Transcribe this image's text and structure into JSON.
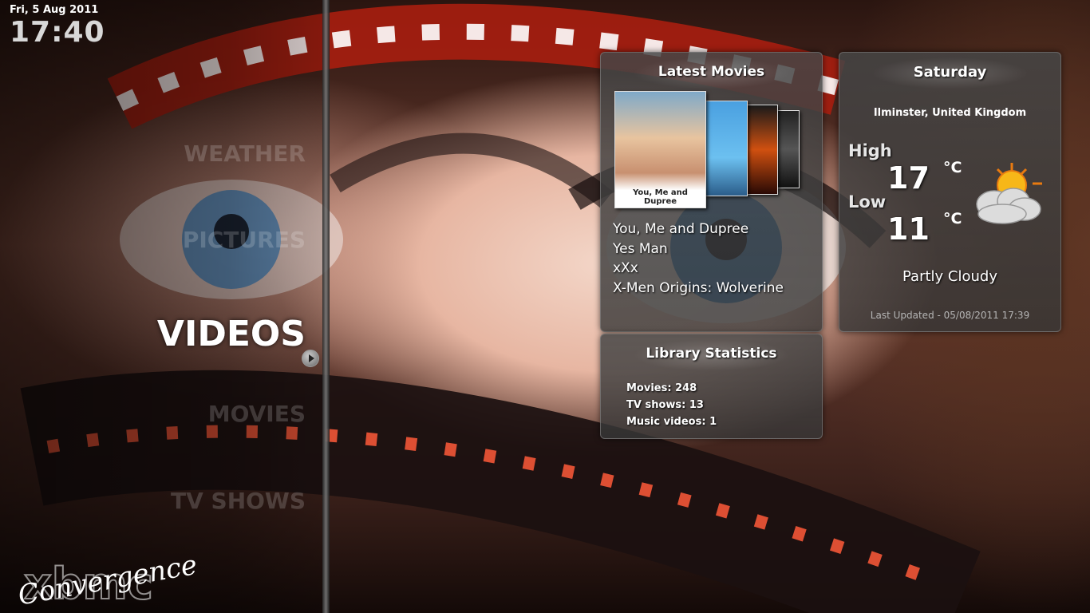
{
  "clock": {
    "date": "Fri, 5 Aug 2011",
    "time": "17:40"
  },
  "menu": {
    "items": [
      "WEATHER",
      "PICTURES",
      "VIDEOS",
      "MOVIES",
      "TV SHOWS"
    ],
    "selected": "VIDEOS"
  },
  "logo": {
    "text": "Convergence",
    "icon": "xbmc-logo"
  },
  "latest_movies": {
    "title": "Latest Movies",
    "poster_caption": "You, Me and Dupree",
    "items": [
      "You, Me and Dupree",
      "Yes Man",
      "xXx",
      "X-Men Origins: Wolverine"
    ]
  },
  "library": {
    "title": "Library Statistics",
    "movies": "Movies: 248",
    "tv_shows": "TV shows: 13",
    "music_videos": "Music videos: 1"
  },
  "weather": {
    "day": "Saturday",
    "location": "Ilminster, United Kingdom",
    "high_label": "High",
    "high": "17",
    "low_label": "Low",
    "low": "11",
    "unit": "°C",
    "condition": "Partly Cloudy",
    "updated": "Last Updated - 05/08/2011 17:39",
    "icon": "partly-cloudy-icon"
  }
}
